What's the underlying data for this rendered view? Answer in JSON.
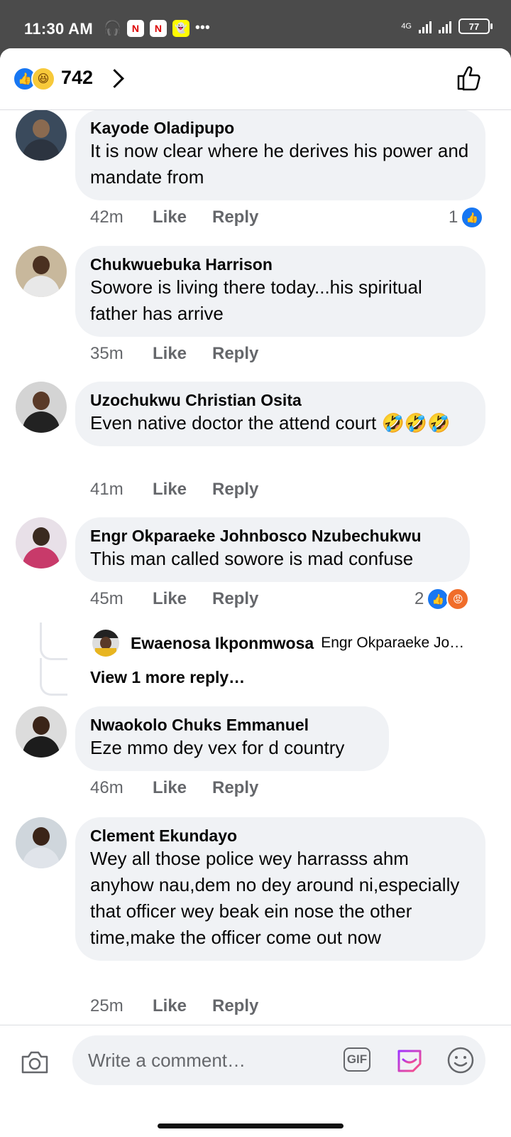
{
  "status_bar": {
    "time": "11:30 AM",
    "network": "4G",
    "battery": "77"
  },
  "header": {
    "reaction_count": "742",
    "reaction_icons": [
      "like-icon",
      "haha-icon"
    ]
  },
  "comments": [
    {
      "name": "Kayode Oladipupo",
      "text": "It is now clear where he derives his power and mandate from",
      "time": "42m",
      "like": "Like",
      "reply": "Reply",
      "reaction_count": "1"
    },
    {
      "name": "Chukwuebuka Harrison",
      "text": "Sowore is living there today...his spiritual father has arrive",
      "time": "35m",
      "like": "Like",
      "reply": "Reply"
    },
    {
      "name": "Uzochukwu Christian Osita",
      "text": "Even native doctor the attend court",
      "emoji": "🤣🤣🤣",
      "time": "41m",
      "like": "Like",
      "reply": "Reply"
    },
    {
      "name": "Engr Okparaeke Johnbosco Nzubechukwu",
      "text": "This man called sowore is mad confuse",
      "time": "45m",
      "like": "Like",
      "reply": "Reply",
      "reaction_count": "2"
    },
    {
      "name": "Nwaokolo Chuks Emmanuel",
      "text": "Eze mmo dey vex for d country",
      "time": "46m",
      "like": "Like",
      "reply": "Reply"
    },
    {
      "name": "Clement Ekundayo",
      "text": "Wey all those police wey harrasss ahm anyhow nau,dem no dey around ni,especially that officer wey beak ein nose the other time,make the officer come out now",
      "time": "25m",
      "like": "Like",
      "reply": "Reply"
    }
  ],
  "reply_preview": {
    "name": "Ewaenosa Ikponmwosa",
    "text": "Engr Okparaeke Jo…",
    "view_more": "View 1 more reply…"
  },
  "composer": {
    "placeholder": "Write a comment…",
    "gif_label": "GIF"
  },
  "colors": {
    "accent": "#1877f2",
    "bubble": "#f0f2f5",
    "muted": "#65676b"
  }
}
